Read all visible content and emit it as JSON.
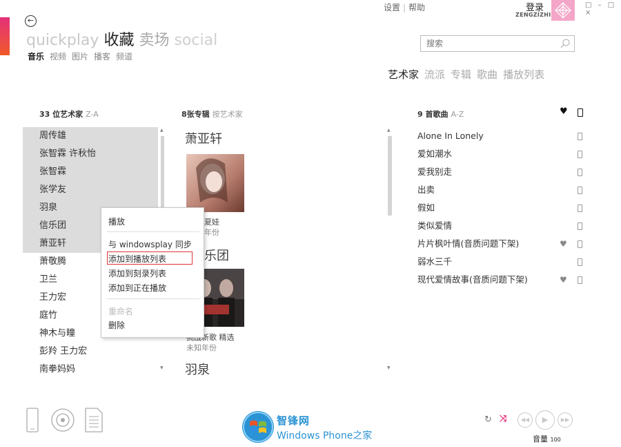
{
  "header": {
    "settings": "设置",
    "help": "帮助",
    "separator": "|",
    "login": "登录",
    "username": "ZENGZIZHI",
    "window_controls": "□ – □ ×"
  },
  "nav": {
    "main": [
      "quickplay",
      "收藏",
      "卖场",
      "social"
    ],
    "sub": [
      "音乐",
      "视频",
      "图片",
      "播客",
      "频道"
    ]
  },
  "search": {
    "placeholder": "搜索"
  },
  "view_tabs": [
    "艺术家",
    "流派",
    "专辑",
    "歌曲",
    "播放列表"
  ],
  "artists": {
    "count_label": "33 位艺术家",
    "sort": "Z-A",
    "items": [
      "周传雄",
      "张智霖 许秋怡",
      "张智霖",
      "张学友",
      "羽泉",
      "信乐团",
      "萧亚轩",
      "萧敬腾",
      "卫兰",
      "王力宏",
      "庭竹",
      "神木与瞳",
      "彭羚 王力宏",
      "南拳妈妈"
    ]
  },
  "albums": {
    "count_label": "8张专辑",
    "sort": "按艺术家",
    "groups": [
      {
        "artist": "萧亚轩",
        "title": "夏娃",
        "year": "年份"
      },
      {
        "artist": "乐团",
        "title": "挑战新歌 精选",
        "year": "未知年份"
      },
      {
        "artist": "羽泉"
      }
    ]
  },
  "songs": {
    "count_label": "9 首歌曲",
    "sort": "A-Z",
    "items": [
      {
        "title": "Alone In Lonely",
        "fav": false
      },
      {
        "title": "爱如潮水",
        "fav": false
      },
      {
        "title": "爱我别走",
        "fav": false
      },
      {
        "title": "出卖",
        "fav": false
      },
      {
        "title": "假如",
        "fav": false
      },
      {
        "title": "类似爱情",
        "fav": false
      },
      {
        "title": "片片枫叶情(音质问题下架)",
        "fav": true
      },
      {
        "title": "弱水三千",
        "fav": false
      },
      {
        "title": "现代爱情故事(音质问题下架)",
        "fav": true
      }
    ]
  },
  "context_menu": {
    "play": "播放",
    "sync": "与 windowsplay 同步",
    "add_playlist": "添加到播放列表",
    "add_burn": "添加到刻录列表",
    "add_now_playing": "添加到正在播放",
    "rename": "重命名",
    "delete": "删除"
  },
  "branding": {
    "cn": "智锋网",
    "en": "Windows Phone之家"
  },
  "player": {
    "volume_label": "音量",
    "volume_value": "100"
  },
  "colors": {
    "accent": "#e4307a",
    "brand": "#2a93d5",
    "selection": "#dcdcdc",
    "highlight_border": "#dd3333"
  }
}
